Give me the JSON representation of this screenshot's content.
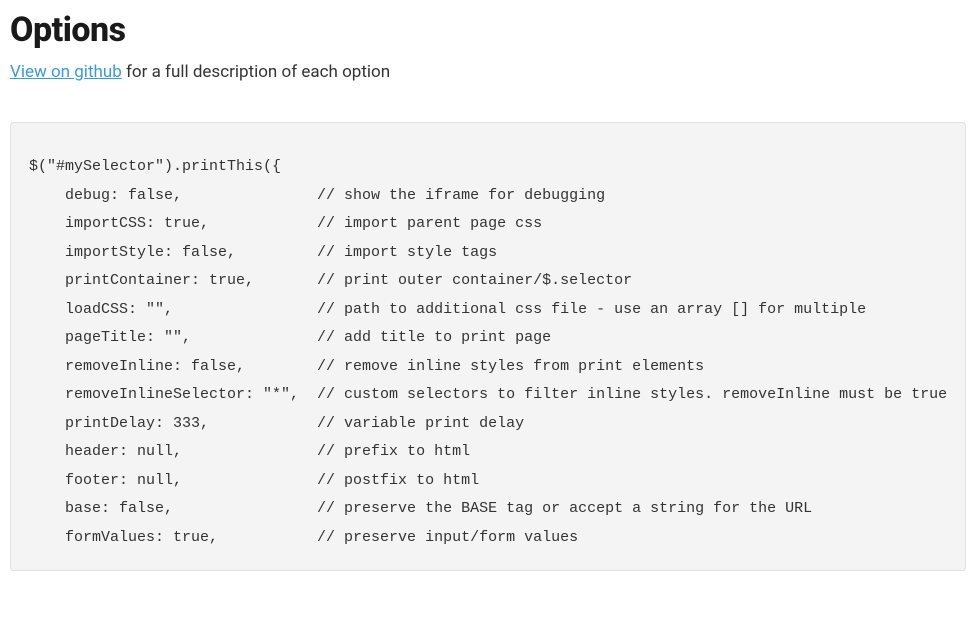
{
  "heading": "Options",
  "link_text": "View on github",
  "subtitle_suffix": " for a full description of each option",
  "code": "$(\"#mySelector\").printThis({\n    debug: false,               // show the iframe for debugging\n    importCSS: true,            // import parent page css\n    importStyle: false,         // import style tags\n    printContainer: true,       // print outer container/$.selector\n    loadCSS: \"\",                // path to additional css file - use an array [] for multiple\n    pageTitle: \"\",              // add title to print page\n    removeInline: false,        // remove inline styles from print elements\n    removeInlineSelector: \"*\",  // custom selectors to filter inline styles. removeInline must be true\n    printDelay: 333,            // variable print delay\n    header: null,               // prefix to html\n    footer: null,               // postfix to html\n    base: false,                // preserve the BASE tag or accept a string for the URL\n    formValues: true,           // preserve input/form values"
}
